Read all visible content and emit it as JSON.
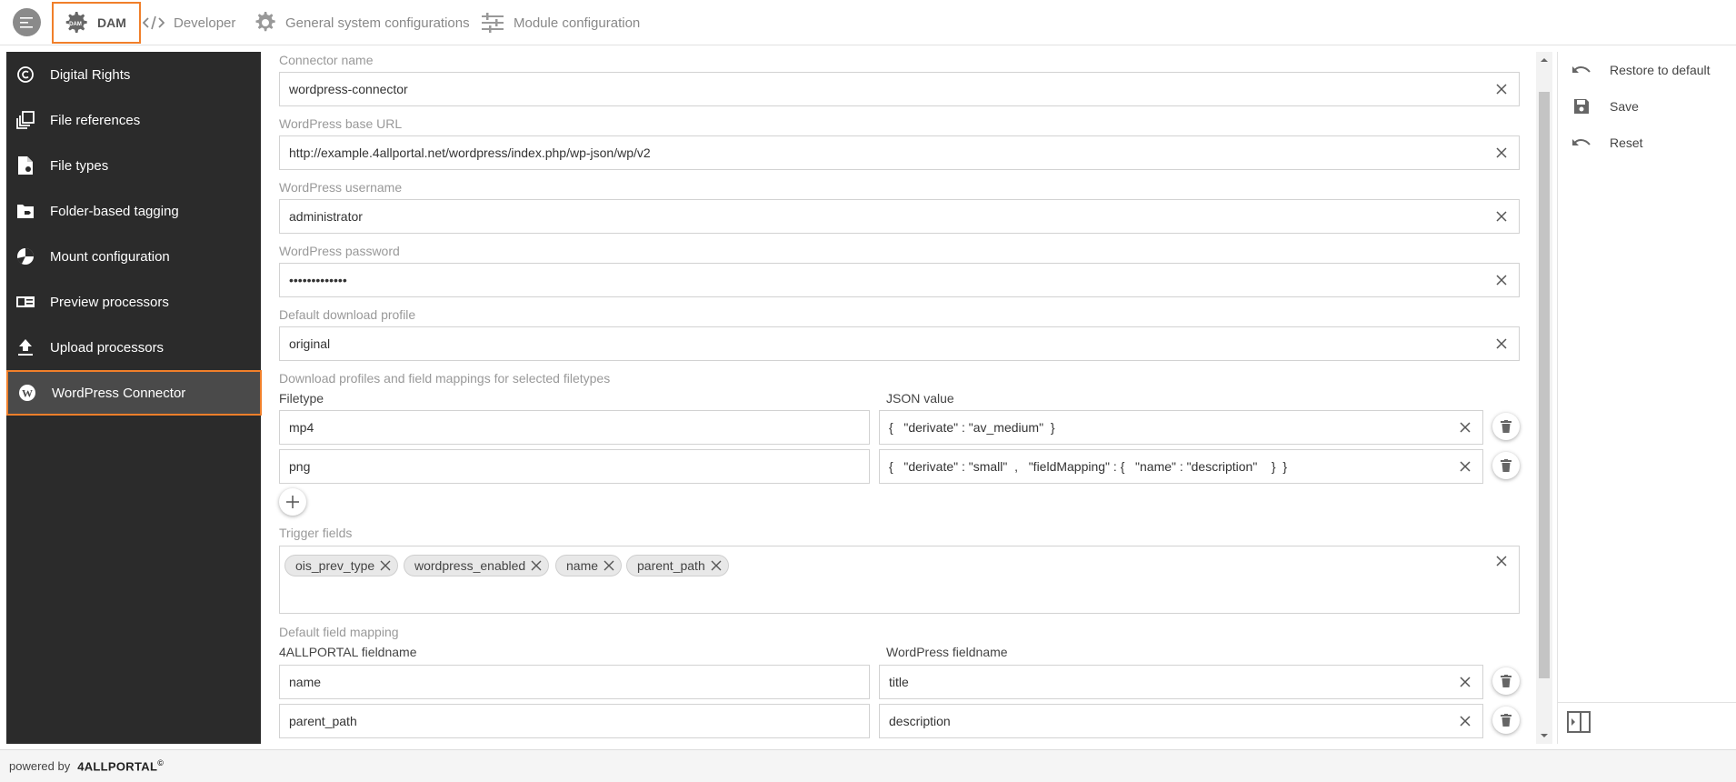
{
  "topbar": {
    "tabs": [
      {
        "label": "DAM",
        "icon": "dam-gear-icon",
        "active": true
      },
      {
        "label": "Developer",
        "icon": "code-icon"
      },
      {
        "label": "General system configurations",
        "icon": "gear-icon"
      },
      {
        "label": "Module configuration",
        "icon": "sliders-icon"
      }
    ],
    "dam_badge": "DAM"
  },
  "sidebar": {
    "items": [
      {
        "label": "Digital Rights",
        "icon": "copyright-icon"
      },
      {
        "label": "File references",
        "icon": "file-references-icon"
      },
      {
        "label": "File types",
        "icon": "file-types-icon"
      },
      {
        "label": "Folder-based tagging",
        "icon": "folder-tag-icon"
      },
      {
        "label": "Mount configuration",
        "icon": "mount-icon"
      },
      {
        "label": "Preview processors",
        "icon": "preview-icon"
      },
      {
        "label": "Upload processors",
        "icon": "upload-icon"
      },
      {
        "label": "WordPress Connector",
        "icon": "wordpress-icon",
        "active": true
      }
    ]
  },
  "form": {
    "connector_name": {
      "label": "Connector name",
      "value": "wordpress-connector"
    },
    "base_url": {
      "label": "WordPress base URL",
      "value": "http://example.4allportal.net/wordpress/index.php/wp-json/wp/v2"
    },
    "username": {
      "label": "WordPress username",
      "value": "administrator"
    },
    "password": {
      "label": "WordPress password",
      "value": "•••••••••••••"
    },
    "download_profile": {
      "label": "Default download profile",
      "value": "original"
    },
    "profiles_section": {
      "label": "Download profiles and field mappings for selected filetypes",
      "col_filetype": "Filetype",
      "col_json": "JSON value",
      "rows": [
        {
          "filetype": "mp4",
          "json": "{   \"derivate\" : \"av_medium\"  }"
        },
        {
          "filetype": "png",
          "json": "{   \"derivate\" : \"small\"  ,   \"fieldMapping\" : {   \"name\" : \"description\"    }  }"
        }
      ]
    },
    "trigger_fields": {
      "label": "Trigger fields",
      "chips": [
        "ois_prev_type",
        "wordpress_enabled",
        "name",
        "parent_path"
      ]
    },
    "field_mapping": {
      "label": "Default field mapping",
      "col_4allportal": "4ALLPORTAL fieldname",
      "col_wordpress": "WordPress fieldname",
      "rows": [
        {
          "portal": "name",
          "wordpress": "title"
        },
        {
          "portal": "parent_path",
          "wordpress": "description"
        }
      ]
    }
  },
  "actions": [
    {
      "label": "Restore to default",
      "icon": "undo-icon"
    },
    {
      "label": "Save",
      "icon": "save-icon"
    },
    {
      "label": "Reset",
      "icon": "undo-icon"
    }
  ],
  "footer": {
    "powered_by": "powered by",
    "brand": "4ALLPORTAL",
    "mark": "©"
  },
  "colors": {
    "accent": "#f07f2a",
    "sidebar_bg": "#2b2b2b",
    "sidebar_active": "#4a4a4a"
  }
}
